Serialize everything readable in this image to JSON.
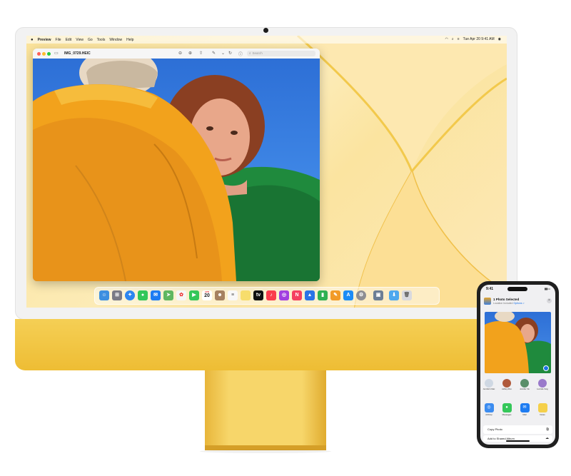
{
  "menubar": {
    "apple": "",
    "items": [
      "Preview",
      "File",
      "Edit",
      "View",
      "Go",
      "Tools",
      "Window",
      "Help"
    ],
    "clock": "Tue Apr 20 9:41 AM"
  },
  "preview": {
    "title": "IMG_0729.HEIC",
    "search_placeholder": "Search",
    "icons": [
      "sidebar-icon",
      "zoom-out-icon",
      "zoom-in-icon",
      "share-icon",
      "markup-icon",
      "rotate-icon",
      "info-icon"
    ]
  },
  "dock": {
    "apps": [
      "Finder",
      "Launchpad",
      "Safari",
      "Messages",
      "Mail",
      "Maps",
      "Photos",
      "FaceTime",
      "Calendar",
      "Contacts",
      "Reminders",
      "Notes",
      "TV",
      "Music",
      "Podcasts",
      "News",
      "Keynote",
      "Numbers",
      "Pages",
      "App Store",
      "System Preferences",
      "Preview",
      "Downloads",
      "Trash"
    ],
    "calendar_day": "20",
    "calendar_month": "APR"
  },
  "iphone": {
    "time": "9:41",
    "sheet_title": "1 Photo Selected",
    "sheet_subtitle": "Location Included",
    "options_label": "Options >",
    "people": [
      "Jennifer's Mac",
      "Ashley Rico",
      "Jennifer Xiu",
      "Lucinda Yang"
    ],
    "apps": [
      {
        "label": "AirDrop",
        "color": "#3b8cf0"
      },
      {
        "label": "Messages",
        "color": "#34c759"
      },
      {
        "label": "Mail",
        "color": "#1e7cf2"
      },
      {
        "label": "Notes",
        "color": "#f5d04a"
      }
    ],
    "actions": [
      "Copy Photo",
      "Add to Shared Album"
    ]
  },
  "colors": {
    "imac_yellow": "#f4c94c",
    "wallpaper": "#fbe4a0",
    "sky_blue": "#3f87e6",
    "jacket": "#f2a21c",
    "sweater": "#1f8a3d"
  }
}
